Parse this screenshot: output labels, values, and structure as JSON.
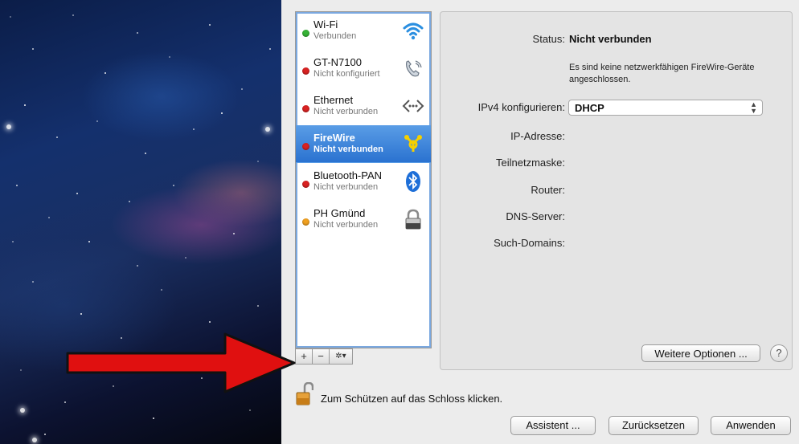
{
  "services": [
    {
      "name": "Wi-Fi",
      "status": "Verbunden",
      "dot_color": "#36b336",
      "icon": "wifi-icon"
    },
    {
      "name": "GT-N7100",
      "status": "Nicht konfiguriert",
      "dot_color": "#d92222",
      "icon": "phone-icon"
    },
    {
      "name": "Ethernet",
      "status": "Nicht verbunden",
      "dot_color": "#d92222",
      "icon": "ethernet-icon"
    },
    {
      "name": "FireWire",
      "status": "Nicht verbunden",
      "dot_color": "#d92222",
      "icon": "firewire-icon",
      "selected": true
    },
    {
      "name": "Bluetooth-PAN",
      "status": "Nicht verbunden",
      "dot_color": "#d92222",
      "icon": "bluetooth-icon"
    },
    {
      "name": "PH Gmünd",
      "status": "Nicht verbunden",
      "dot_color": "#f0a020",
      "icon": "lock-icon"
    }
  ],
  "toolbar": {
    "add": "+",
    "remove": "−",
    "gear": "✲▾"
  },
  "detail": {
    "status_label": "Status:",
    "status_value": "Nicht verbunden",
    "status_note": "Es sind keine netzwerkfähigen FireWire-Geräte angeschlossen.",
    "ipv4_label": "IPv4 konfigurieren:",
    "ipv4_value": "DHCP",
    "ip_label": "IP-Adresse:",
    "subnet_label": "Teilnetzmaske:",
    "router_label": "Router:",
    "dns_label": "DNS-Server:",
    "search_label": "Such-Domains:",
    "more_options": "Weitere Optionen ...",
    "help": "?"
  },
  "footer": {
    "lock_text": "Zum Schützen auf das Schloss klicken.",
    "assistant": "Assistent ...",
    "reset": "Zurücksetzen",
    "apply": "Anwenden"
  },
  "colors": {
    "selection": "#2a72d0",
    "arrow": "#e01010"
  }
}
